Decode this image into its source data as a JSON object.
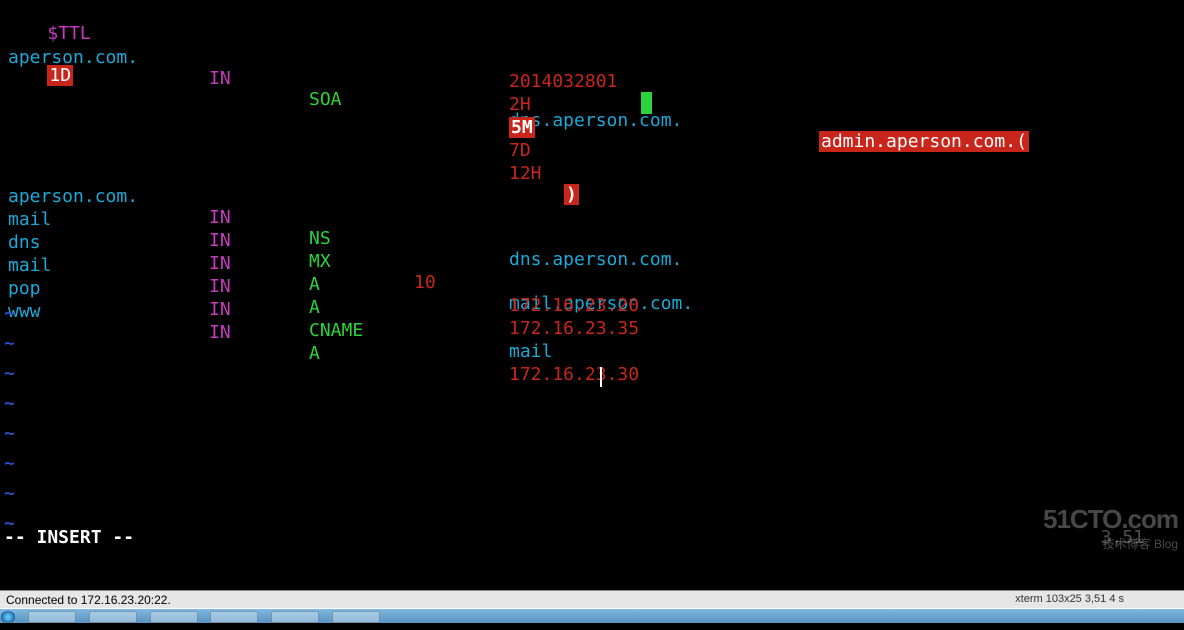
{
  "ttl": {
    "label": "$TTL",
    "value": "1D"
  },
  "records": [
    {
      "name": "aperson.com.",
      "in": "IN",
      "type": "SOA",
      "prio": "",
      "value": "dns.aperson.com.",
      "admin": "admin.aperson.com.("
    },
    {
      "name": "aperson.com.",
      "in": "IN",
      "type": "NS",
      "prio": "",
      "value": "dns.aperson.com."
    },
    {
      "name": "mail",
      "in": "IN",
      "type": "MX",
      "prio": "10",
      "value": "mail.aperson.com."
    },
    {
      "name": "dns",
      "in": "IN",
      "type": "A",
      "prio": "",
      "value": "172.16.23.20"
    },
    {
      "name": "mail",
      "in": "IN",
      "type": "A",
      "prio": "",
      "value": "172.16.23.35"
    },
    {
      "name": "pop",
      "in": "IN",
      "type": "CNAME",
      "prio": "",
      "value": "mail"
    },
    {
      "name": "www",
      "in": "IN",
      "type": "A",
      "prio": "",
      "value": "172.16.23.30"
    }
  ],
  "soa_block": {
    "serial": "2014032801",
    "refresh": "2H",
    "retry": "5M",
    "expire": "7D",
    "negttl": "12H",
    "close": ")"
  },
  "tildes": [
    0,
    1,
    2,
    3,
    4,
    5,
    6,
    7
  ],
  "vim_mode": "-- INSERT --",
  "vim_pos": "3,51",
  "connection": "Connected to 172.16.23.20:22.",
  "xterm": "xterm 103x25 3,51   4 s",
  "watermark": {
    "main": "51CTO.com",
    "sub": "技术博客  Blog"
  }
}
